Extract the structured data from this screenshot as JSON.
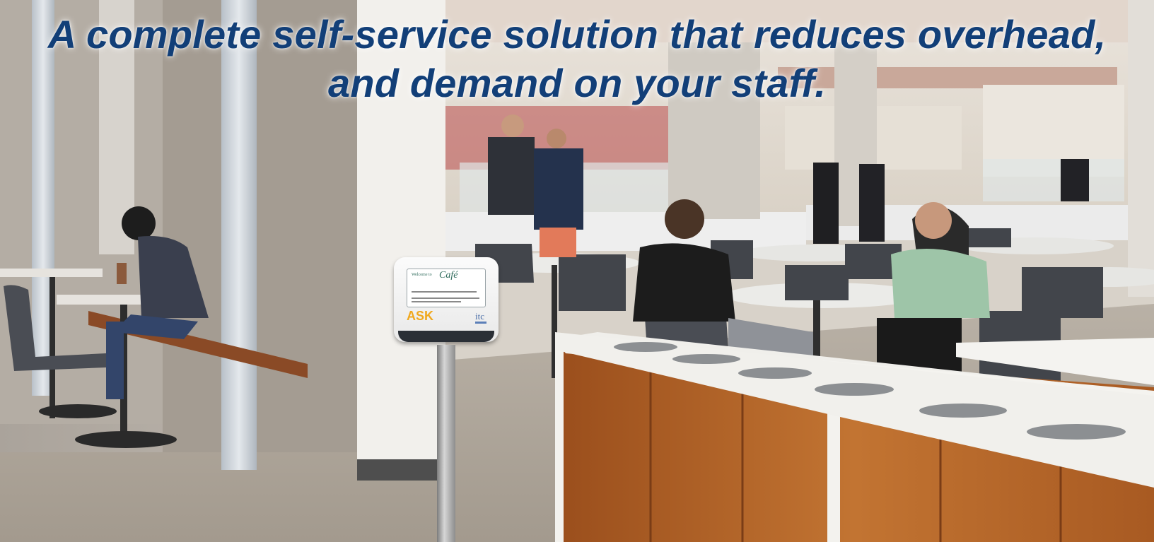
{
  "headline": {
    "line1": "A complete self-service solution that reduces overhead,",
    "line2": "and demand on your staff.",
    "color": "#123f78"
  },
  "kiosk": {
    "screen_welcome": "Welcome to",
    "screen_title": "Café",
    "brand_label": "ASK",
    "maker_logo": "itc",
    "brand_color": "#f0a81e"
  },
  "photo": {
    "subject": "cafeteria-interior",
    "counter_wood_color": "#b8652a"
  }
}
